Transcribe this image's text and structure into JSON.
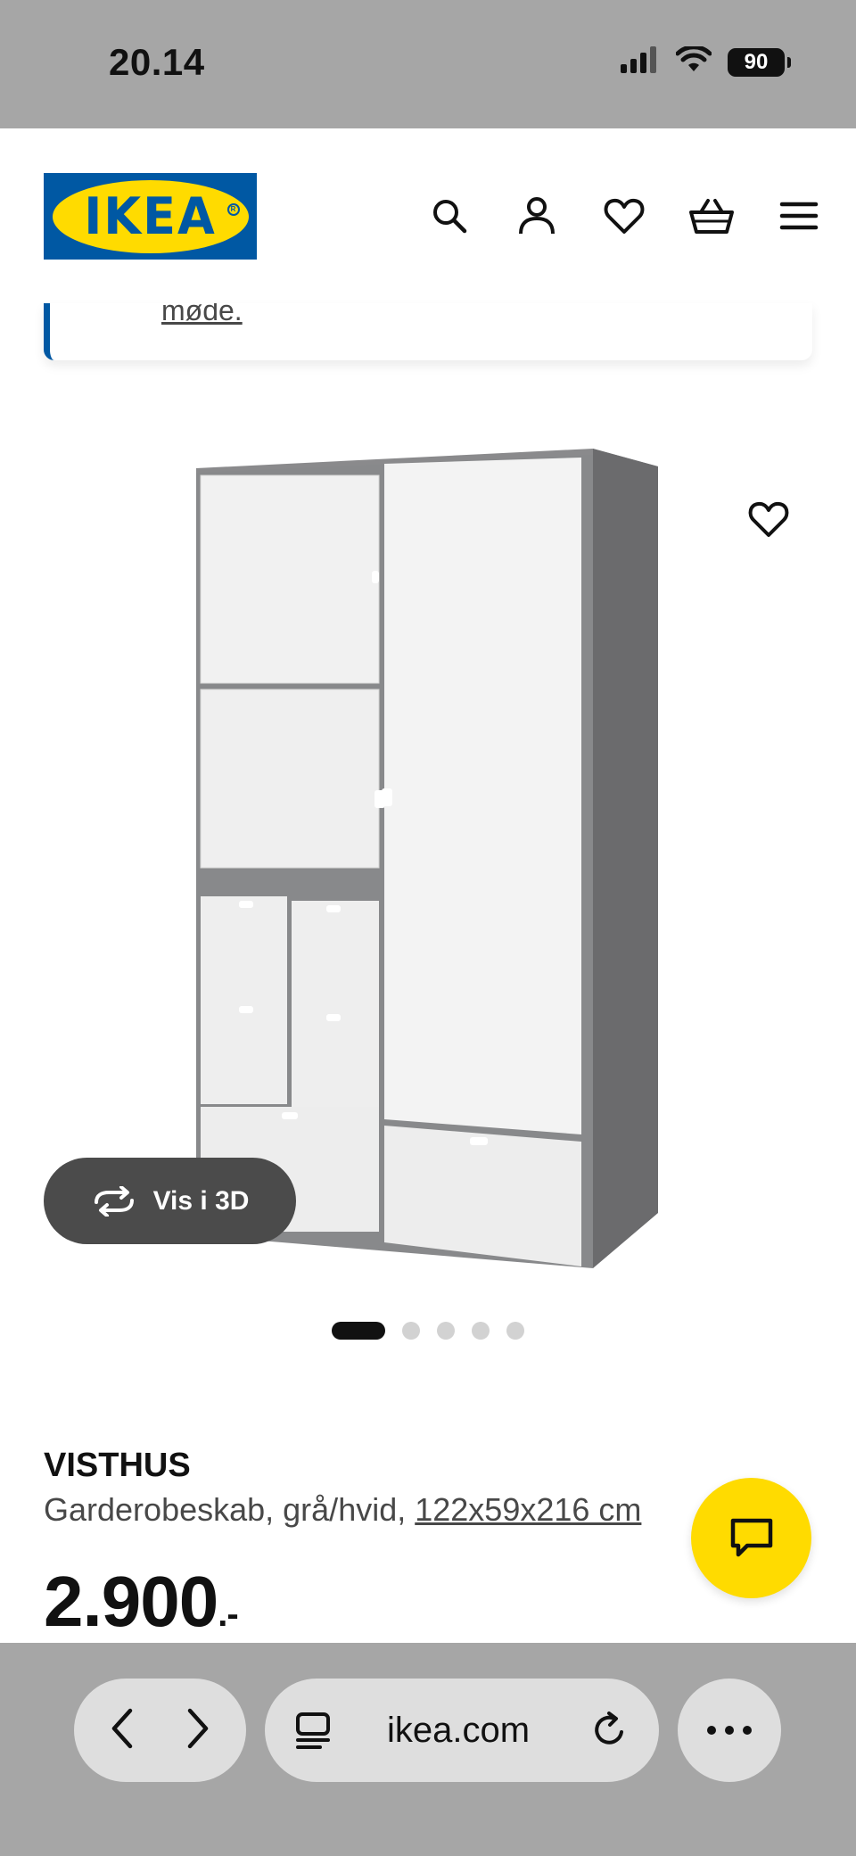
{
  "status_bar": {
    "time": "20.14",
    "battery": "90"
  },
  "header": {
    "logo_text": "IKEA",
    "icons": [
      "search-icon",
      "user-icon",
      "heart-icon",
      "basket-icon",
      "menu-icon"
    ]
  },
  "notice": {
    "link_text": "møde."
  },
  "gallery": {
    "view_3d_label": "Vis i 3D",
    "image_count": 5,
    "active_index": 0
  },
  "product": {
    "name": "VISTHUS",
    "description": "Garderobeskab, grå/hvid, ",
    "dimensions": "122x59x216 cm",
    "price": "2.900",
    "price_suffix": ".-"
  },
  "browser": {
    "url": "ikea.com"
  },
  "colors": {
    "ikea_blue": "#0058a3",
    "ikea_yellow": "#ffdb00",
    "browser_gray": "#a6a6a6"
  }
}
